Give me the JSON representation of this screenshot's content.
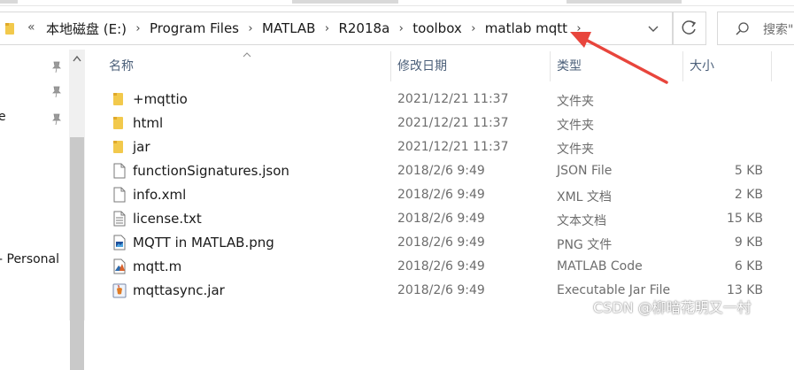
{
  "address_bar": {
    "overflow": "«",
    "breadcrumbs": [
      "本地磁盘 (E:)",
      "Program Files",
      "MATLAB",
      "R2018a",
      "toolbox",
      "matlab mqtt"
    ]
  },
  "search": {
    "placeholder": "搜索\""
  },
  "nav": {
    "fragments": [
      "e",
      "- Personal"
    ]
  },
  "columns": {
    "name": "名称",
    "modified": "修改日期",
    "type": "类型",
    "size": "大小"
  },
  "files": [
    {
      "name": "+mqttio",
      "modified": "2021/12/21 11:37",
      "type": "文件夹",
      "size": "",
      "icon": "folder-icon"
    },
    {
      "name": "html",
      "modified": "2021/12/21 11:37",
      "type": "文件夹",
      "size": "",
      "icon": "folder-icon"
    },
    {
      "name": "jar",
      "modified": "2021/12/21 11:37",
      "type": "文件夹",
      "size": "",
      "icon": "folder-icon"
    },
    {
      "name": "functionSignatures.json",
      "modified": "2018/2/6 9:49",
      "type": "JSON File",
      "size": "5 KB",
      "icon": "json-file-icon"
    },
    {
      "name": "info.xml",
      "modified": "2018/2/6 9:49",
      "type": "XML 文档",
      "size": "2 KB",
      "icon": "xml-file-icon"
    },
    {
      "name": "license.txt",
      "modified": "2018/2/6 9:49",
      "type": "文本文档",
      "size": "15 KB",
      "icon": "text-file-icon"
    },
    {
      "name": "MQTT in MATLAB.png",
      "modified": "2018/2/6 9:49",
      "type": "PNG 文件",
      "size": "9 KB",
      "icon": "image-file-icon"
    },
    {
      "name": "mqtt.m",
      "modified": "2018/2/6 9:49",
      "type": "MATLAB Code",
      "size": "6 KB",
      "icon": "matlab-file-icon"
    },
    {
      "name": "mqttasync.jar",
      "modified": "2018/2/6 9:49",
      "type": "Executable Jar File",
      "size": "13 KB",
      "icon": "jar-file-icon"
    }
  ],
  "annotation": {
    "color": "#e8453c"
  },
  "watermark": "CSDN @柳暗花明又一村"
}
